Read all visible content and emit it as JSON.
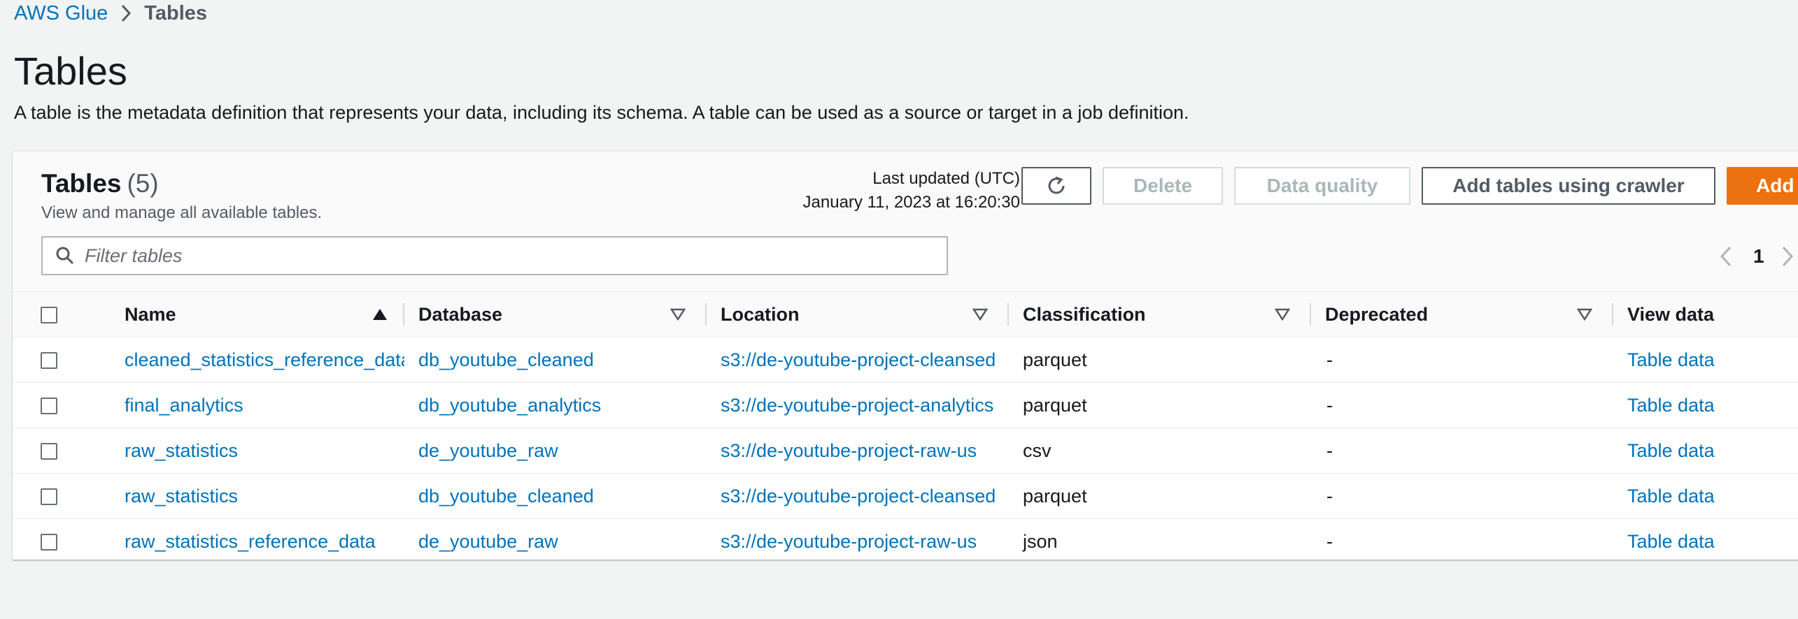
{
  "breadcrumb": {
    "root": "AWS Glue",
    "current": "Tables"
  },
  "page": {
    "title": "Tables",
    "description": "A table is the metadata definition that represents your data, including its schema. A table can be used as a source or target in a job definition."
  },
  "panel": {
    "title": "Tables",
    "count": "(5)",
    "description": "View and manage all available tables.",
    "last_updated_label": "Last updated (UTC)",
    "last_updated_value": "January 11, 2023 at 16:20:30",
    "buttons": {
      "delete": "Delete",
      "data_quality": "Data quality",
      "add_crawler": "Add tables using crawler",
      "add": "Add"
    },
    "filter_placeholder": "Filter tables",
    "page_number": "1"
  },
  "table": {
    "columns": {
      "name": "Name",
      "database": "Database",
      "location": "Location",
      "classification": "Classification",
      "deprecated": "Deprecated",
      "view_data": "View data"
    },
    "rows": [
      {
        "name": "cleaned_statistics_reference_data",
        "database": "db_youtube_cleaned",
        "location": "s3://de-youtube-project-cleansed",
        "classification": "parquet",
        "deprecated": "-",
        "view_data": "Table data"
      },
      {
        "name": "final_analytics",
        "database": "db_youtube_analytics",
        "location": "s3://de-youtube-project-analytics",
        "classification": "parquet",
        "deprecated": "-",
        "view_data": "Table data"
      },
      {
        "name": "raw_statistics",
        "database": "de_youtube_raw",
        "location": "s3://de-youtube-project-raw-us",
        "classification": "csv",
        "deprecated": "-",
        "view_data": "Table data"
      },
      {
        "name": "raw_statistics",
        "database": "db_youtube_cleaned",
        "location": "s3://de-youtube-project-cleansed",
        "classification": "parquet",
        "deprecated": "-",
        "view_data": "Table data"
      },
      {
        "name": "raw_statistics_reference_data",
        "database": "de_youtube_raw",
        "location": "s3://de-youtube-project-raw-us",
        "classification": "json",
        "deprecated": "-",
        "view_data": "Table data"
      }
    ]
  },
  "colors": {
    "link": "#0073bb",
    "primary_button": "#ec7211",
    "background": "#f2f3f3"
  }
}
